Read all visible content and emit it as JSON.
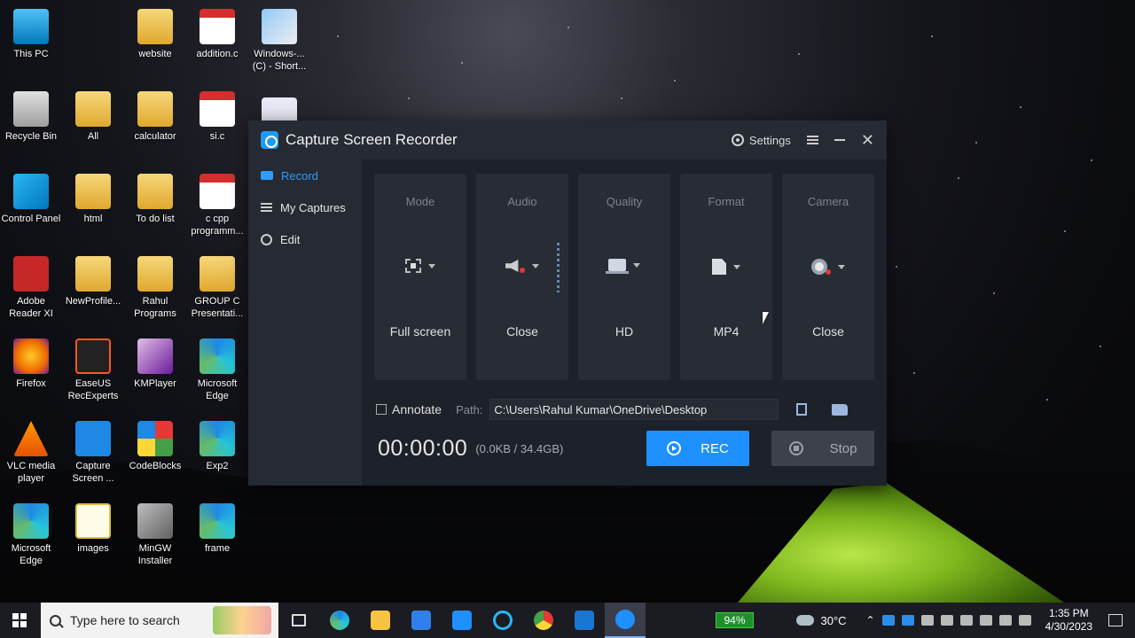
{
  "desktop": {
    "icons": [
      {
        "label": "This PC"
      },
      {
        "label": "website"
      },
      {
        "label": "addition.c"
      },
      {
        "label": "Windows-... (C) - Short..."
      },
      {
        "label": "Recycle Bin"
      },
      {
        "label": "All"
      },
      {
        "label": "calculator"
      },
      {
        "label": "si.c"
      },
      {
        "label": "Control Panel"
      },
      {
        "label": "html"
      },
      {
        "label": "To do list"
      },
      {
        "label": "c cpp programm..."
      },
      {
        "label": "Adobe Reader XI"
      },
      {
        "label": "NewProfile..."
      },
      {
        "label": "Rahul Programs"
      },
      {
        "label": "GROUP C Presentati..."
      },
      {
        "label": "Firefox"
      },
      {
        "label": "EaseUS RecExperts"
      },
      {
        "label": "KMPlayer"
      },
      {
        "label": "Microsoft Edge"
      },
      {
        "label": "VLC media player"
      },
      {
        "label": "Capture Screen ..."
      },
      {
        "label": "CodeBlocks"
      },
      {
        "label": "Exp2"
      },
      {
        "label": "Microsoft Edge"
      },
      {
        "label": "images"
      },
      {
        "label": "MinGW Installer"
      },
      {
        "label": "frame"
      }
    ]
  },
  "app": {
    "title": "Capture Screen Recorder",
    "settings_label": "Settings",
    "nav": [
      {
        "label": "Record"
      },
      {
        "label": "My Captures"
      },
      {
        "label": "Edit"
      }
    ],
    "cards": [
      {
        "title": "Mode",
        "value": "Full screen",
        "icon": "fullscreen-icon"
      },
      {
        "title": "Audio",
        "value": "Close",
        "icon": "speaker-muted-icon"
      },
      {
        "title": "Quality",
        "value": "HD",
        "icon": "laptop-icon"
      },
      {
        "title": "Format",
        "value": "MP4",
        "icon": "file-icon"
      },
      {
        "title": "Camera",
        "value": "Close",
        "icon": "webcam-off-icon"
      }
    ],
    "annotate_label": "Annotate",
    "path_label": "Path:",
    "path_value": "C:\\Users\\Rahul Kumar\\OneDrive\\Desktop",
    "timer": "00:00:00",
    "size_info": "(0.0KB / 34.4GB)",
    "rec_label": "REC",
    "stop_label": "Stop",
    "accent_color": "#1e90ff"
  },
  "taskbar": {
    "search_placeholder": "Type here to search",
    "battery": "94%",
    "temperature": "30°C",
    "time": "1:35 PM",
    "date": "4/30/2023"
  }
}
